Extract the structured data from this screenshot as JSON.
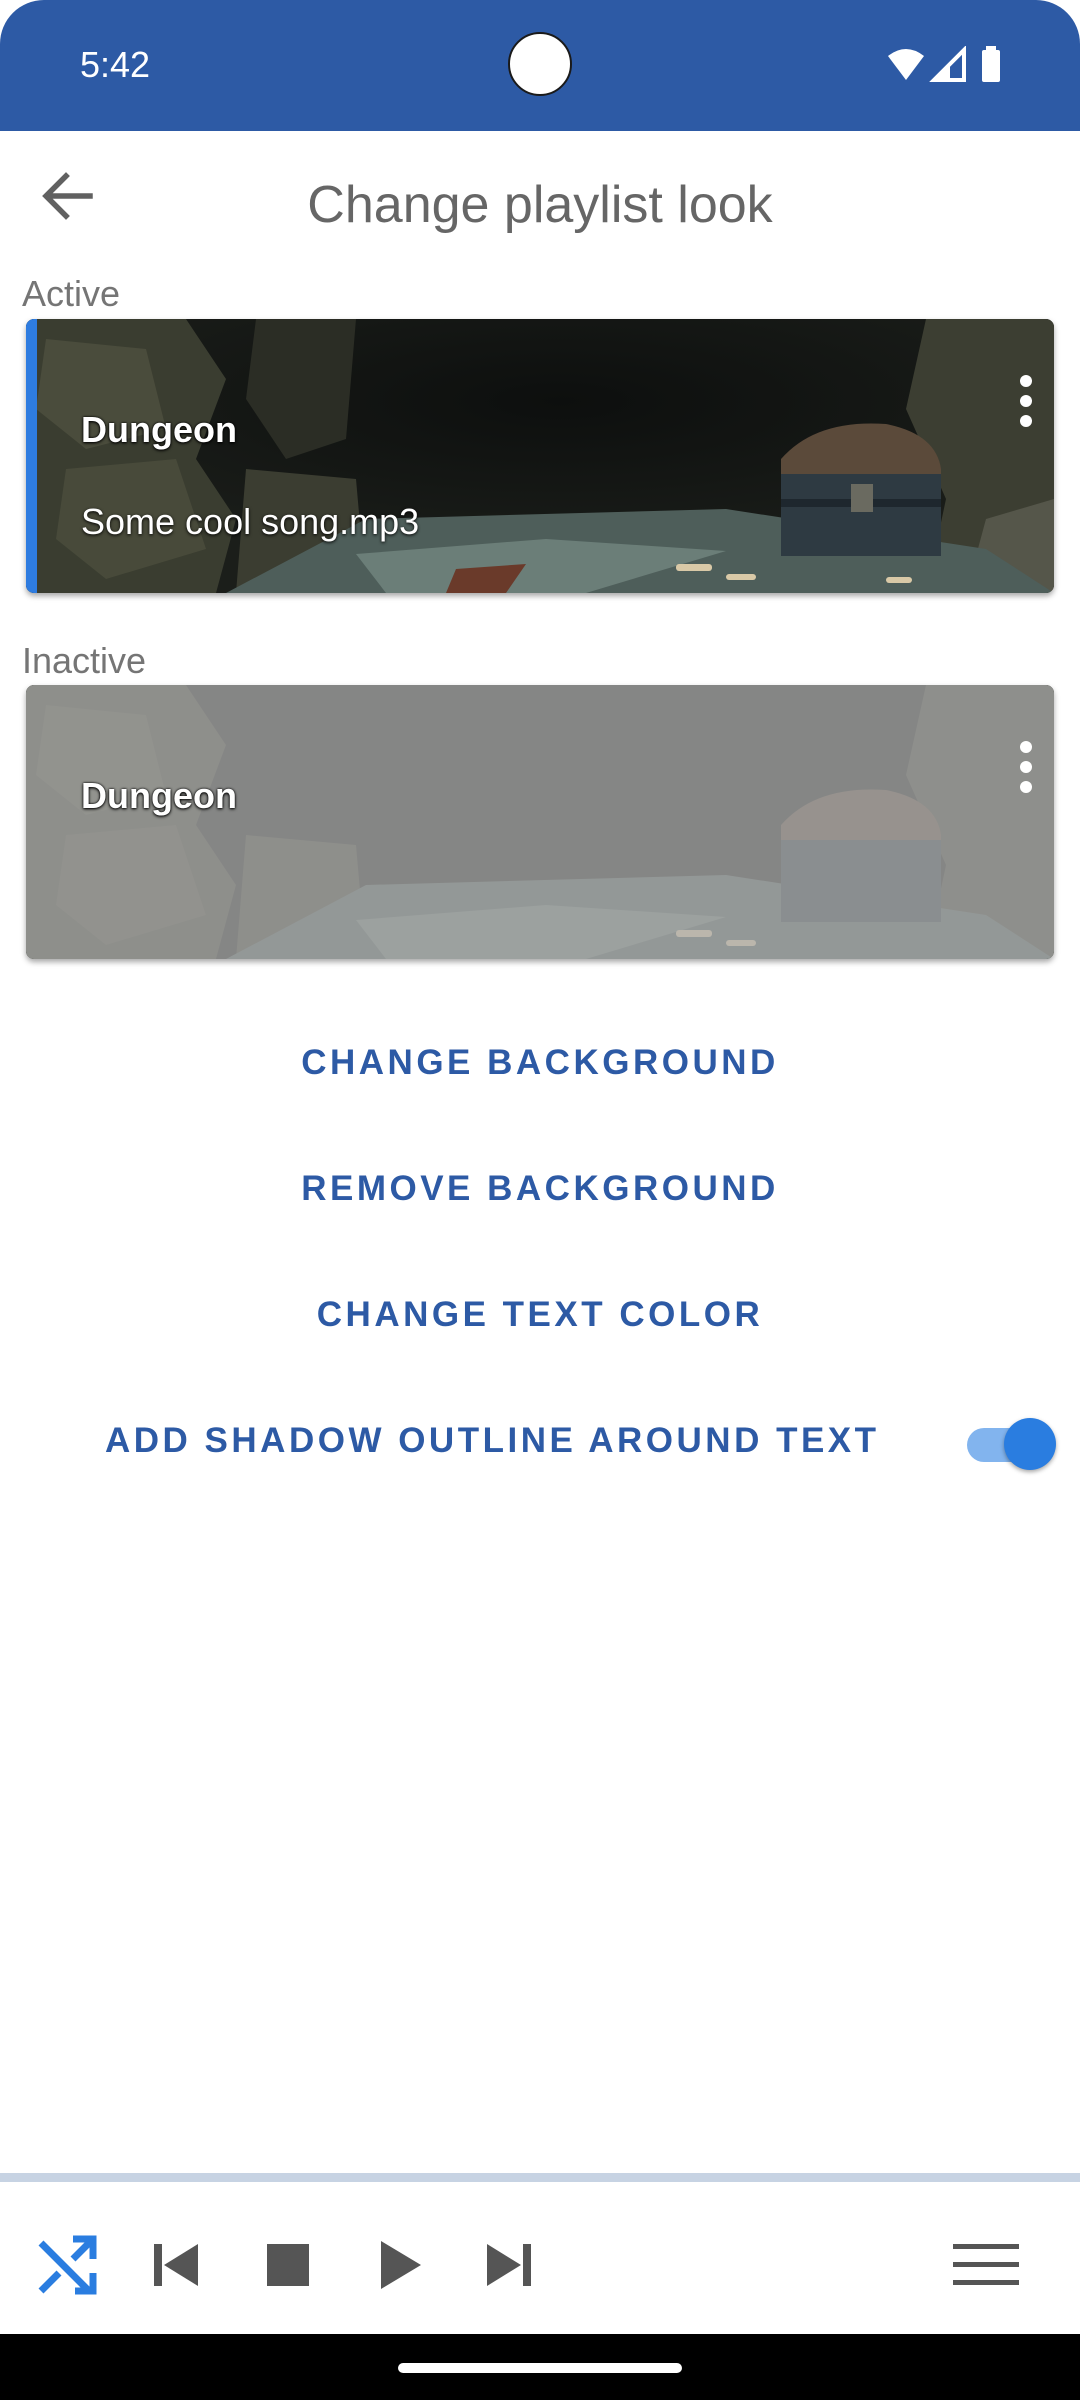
{
  "status_bar": {
    "time": "5:42"
  },
  "app_bar": {
    "title": "Change playlist look"
  },
  "sections": {
    "active_label": "Active",
    "inactive_label": "Inactive"
  },
  "active_card": {
    "title": "Dungeon",
    "song": "Some cool song.mp3"
  },
  "inactive_card": {
    "title": "Dungeon"
  },
  "actions": {
    "change_background": "CHANGE BACKGROUND",
    "remove_background": "REMOVE BACKGROUND",
    "change_text_color": "CHANGE TEXT COLOR",
    "shadow_outline": "ADD SHADOW OUTLINE AROUND TEXT",
    "shadow_outline_enabled": true
  },
  "player": {
    "buttons": [
      "shuffle-icon",
      "previous-icon",
      "stop-icon",
      "play-icon",
      "next-icon",
      "menu-icon"
    ],
    "shuffle_active": true
  },
  "colors": {
    "status_bar": "#2d5aa5",
    "accent": "#2e7ce0",
    "button_text": "#2d5aa5"
  }
}
